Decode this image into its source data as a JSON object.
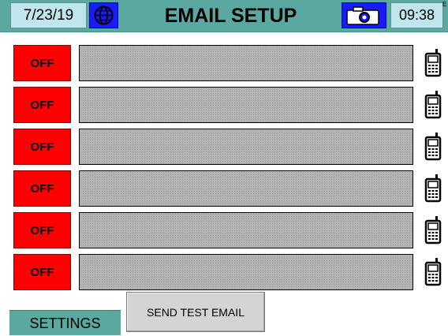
{
  "header": {
    "date": "7/23/19",
    "title": "EMAIL SETUP",
    "time": "09:38",
    "globe_icon": "globe-icon",
    "camera_icon": "camera-icon",
    "corner_mark": "E"
  },
  "colors": {
    "header_bg": "#5ba8a0",
    "box_bg": "#bfe6ec",
    "icon_button_bg": "#1a1aff",
    "off_button_bg": "#ff0000",
    "field_bg": "#b3b3b3",
    "send_button_bg": "#d4d4d4"
  },
  "rows": [
    {
      "status": "OFF",
      "email": "",
      "icon": "phone-icon"
    },
    {
      "status": "OFF",
      "email": "",
      "icon": "phone-icon"
    },
    {
      "status": "OFF",
      "email": "",
      "icon": "phone-icon"
    },
    {
      "status": "OFF",
      "email": "",
      "icon": "phone-icon"
    },
    {
      "status": "OFF",
      "email": "",
      "icon": "phone-icon"
    },
    {
      "status": "OFF",
      "email": "",
      "icon": "phone-icon"
    }
  ],
  "footer": {
    "settings_label": "SETTINGS",
    "send_test_label": "SEND TEST EMAIL"
  }
}
